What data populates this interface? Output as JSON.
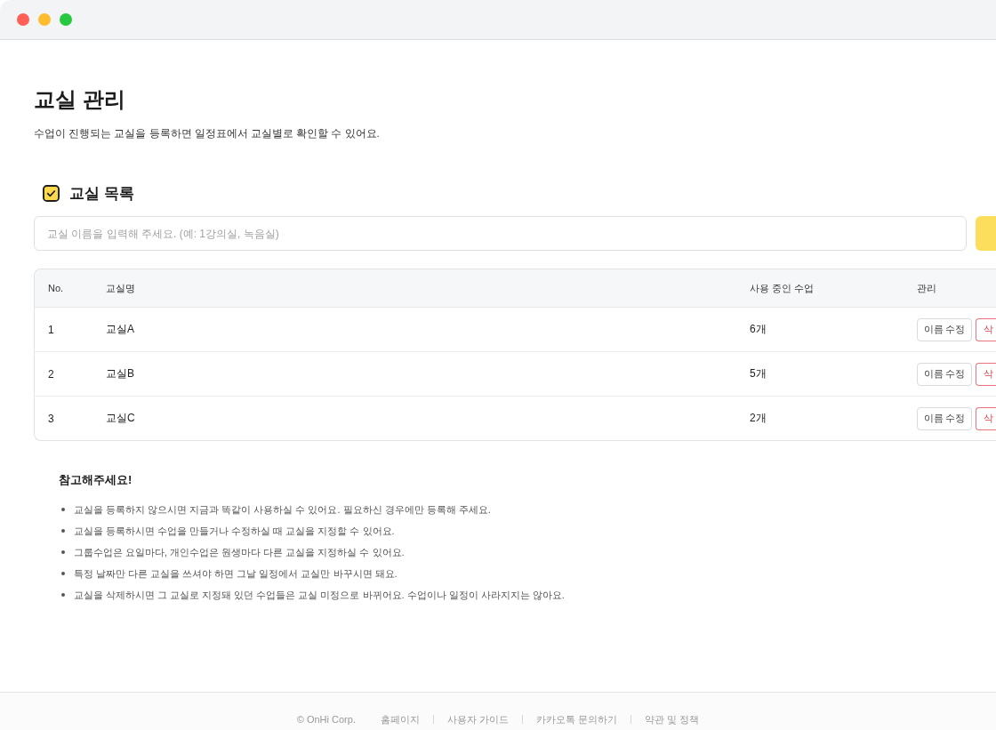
{
  "window": {
    "controls": [
      {
        "color": "#ff5f57"
      },
      {
        "color": "#febc2e"
      },
      {
        "color": "#28c840"
      }
    ]
  },
  "page": {
    "title": "교실 관리",
    "description": "수업이 진행되는 교실을 등록하면 일정표에서 교실별로 확인할 수 있어요."
  },
  "section": {
    "title": "교실 목록"
  },
  "name_input": {
    "placeholder": "교실 이름을 입력해 주세요. (예: 1강의실, 녹음실)"
  },
  "table": {
    "columns": [
      "No.",
      "교실명",
      "사용 중인 수업",
      "관리"
    ],
    "rows": [
      {
        "no": "1",
        "name": "교실A",
        "classes": "6개",
        "actions": [
          {
            "kind": "edit",
            "label": "이름 수정"
          },
          {
            "kind": "delete",
            "label": "삭"
          }
        ]
      },
      {
        "no": "2",
        "name": "교실B",
        "classes": "5개",
        "actions": [
          {
            "kind": "edit",
            "label": "이름 수정"
          },
          {
            "kind": "delete",
            "label": "삭"
          }
        ]
      },
      {
        "no": "3",
        "name": "교실C",
        "classes": "2개",
        "actions": [
          {
            "kind": "edit",
            "label": "이름 수정"
          },
          {
            "kind": "delete",
            "label": "삭"
          }
        ]
      }
    ]
  },
  "notes": {
    "title": "참고해주세요!",
    "items": [
      "교실을 등록하지 않으시면 지금과 똑같이 사용하실 수 있어요. 필요하신 경우에만 등록해 주세요.",
      "교실을 등록하시면 수업을 만들거나 수정하실 때 교실을 지정할 수 있어요.",
      "그룹수업은 요일마다, 개인수업은 원생마다 다른 교실을 지정하실 수 있어요.",
      "특정 날짜만 다른 교실을 쓰셔야 하면 그날 일정에서 교실만 바꾸시면 돼요.",
      "교실을 삭제하시면 그 교실로 지정돼 있던 수업들은 교실 미정으로 바뀌어요. 수업이나 일정이 사라지지는 않아요."
    ]
  },
  "footer": {
    "copyright": "© OnHi Corp.",
    "links": [
      "홈페이지",
      "사용자 가이드",
      "카카오톡 문의하기",
      "약관 및 정책"
    ]
  }
}
